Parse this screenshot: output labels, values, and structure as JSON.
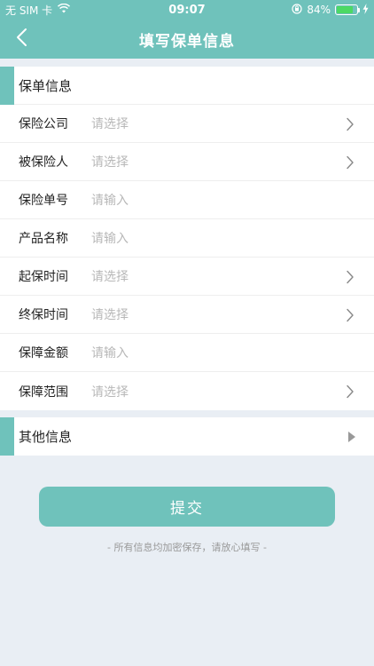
{
  "status_bar": {
    "carrier": "无 SIM 卡",
    "time": "09:07",
    "battery_percent": "84%",
    "battery_level": 0.84,
    "wifi_icon": "wifi-icon",
    "lock_icon": "rotation-lock-icon",
    "charging_icon": "bolt-icon"
  },
  "nav": {
    "title": "填写保单信息",
    "back_icon": "chevron-left-icon"
  },
  "policy_section": {
    "title": "保单信息",
    "rows": [
      {
        "label": "保险公司",
        "value": "请选择",
        "has_chevron": true
      },
      {
        "label": "被保险人",
        "value": "请选择",
        "has_chevron": true
      },
      {
        "label": "保险单号",
        "value": "请输入",
        "has_chevron": false
      },
      {
        "label": "产品名称",
        "value": "请输入",
        "has_chevron": false
      },
      {
        "label": "起保时间",
        "value": "请选择",
        "has_chevron": true
      },
      {
        "label": "终保时间",
        "value": "请选择",
        "has_chevron": true
      },
      {
        "label": "保障金额",
        "value": "请输入",
        "has_chevron": false
      },
      {
        "label": "保障范围",
        "value": "请选择",
        "has_chevron": true
      }
    ]
  },
  "other_section": {
    "title": "其他信息",
    "expand_icon": "triangle-right-icon"
  },
  "submit": {
    "label": "提交"
  },
  "footnote": "- 所有信息均加密保存，请放心填写 -",
  "colors": {
    "accent": "#6fc2bb",
    "background": "#e9eef4",
    "placeholder": "#b8b8b8"
  }
}
